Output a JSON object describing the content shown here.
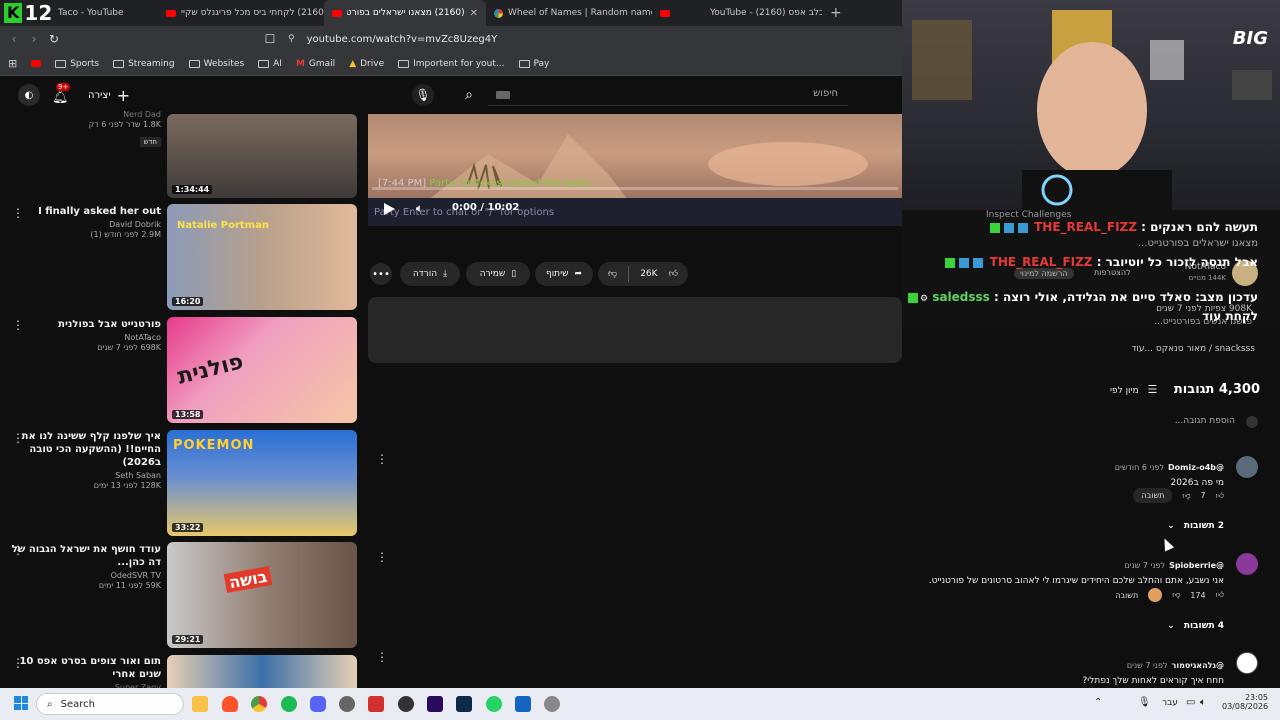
{
  "browser": {
    "tabs": [
      {
        "label": "Taco - YouTube",
        "active": false
      },
      {
        "label": "(2160) לקחתי ביס מכל פריגנלס שקיי",
        "active": false
      },
      {
        "label": "(2160) מצאנו ישראלים בפורטנייט",
        "active": true
      },
      {
        "label": "Wheel of Names | Random name pic",
        "active": false
      },
      {
        "label": "",
        "active": false
      },
      {
        "label": "YouTube - (2160) כלב אפס",
        "active": false
      }
    ],
    "url": "youtube.com/watch?v=mvZc8Uzeg4Y",
    "bookmarks": [
      "Sports",
      "Streaming",
      "Websites",
      "AI",
      "Gmail",
      "Drive",
      "Importent for yout...",
      "Pay"
    ]
  },
  "overlay_logo": {
    "k": "K",
    "num": "12"
  },
  "header": {
    "search_placeholder": "חיפוש",
    "create_label": "יצירה",
    "notif_count": "9+"
  },
  "related": [
    {
      "title": "",
      "channel": "Nerd Dad",
      "meta": "1.8K שדר לפני 6 דק",
      "badge": "חדש",
      "duration": "1:34:44",
      "colors": [
        "#6b5a50",
        "#2a2a2a"
      ]
    },
    {
      "title": "I finally asked her out",
      "channel": "David Dobrik",
      "meta": "2.9M לפני חודש (1)",
      "badge": "",
      "duration": "16:20",
      "thumb_text": "Natalie Portman",
      "colors": [
        "#7d8fb0",
        "#e8c2a8"
      ]
    },
    {
      "title": "פורטנייט אבל בפולנית",
      "channel": "NotATaco",
      "meta": "698K לפני 7 שנים",
      "badge": "",
      "duration": "13:58",
      "thumb_text": "פולנית",
      "colors": [
        "#e83a8a",
        "#f5c7a5"
      ]
    },
    {
      "title": "איך שלפנו קלף ששינה לנו את החיים!! (ההשקעה הכי טובה ב2026)",
      "channel": "Seth Saban",
      "meta": "128K לפני 13 ימים",
      "badge": "",
      "duration": "33:22",
      "thumb_text": "POKEMON",
      "colors": [
        "#2a6fd6",
        "#ffcf33"
      ]
    },
    {
      "title": "עודד חושף את ישראל הגבוה של דה כהן...",
      "channel": "OdedSVR TV",
      "meta": "59K לפני 11 ימים",
      "badge": "",
      "duration": "29:21",
      "thumb_text": "בושה",
      "colors": [
        "#c9c9c9",
        "#e23a2a"
      ]
    },
    {
      "title": "תום ואור צופים בסרט אפס 10 שנים אחרי",
      "channel": "Super Zagy",
      "meta": "",
      "badge": "",
      "duration": "",
      "colors": [
        "#3b6fa8",
        "#e7d0b5"
      ]
    }
  ],
  "player": {
    "overlay_time": "[7:44 PM]",
    "overlay_party": "Party: Sn4cksss joined the party",
    "hint": "Party   Enter to chat or \"/\" for options",
    "time": "0:00 / 10:02"
  },
  "actions": {
    "likes": "26K",
    "share": "שיתוף",
    "save": "שמירה",
    "download": "הורדה"
  },
  "chat": {
    "inspect": "Inspect Challenges",
    "messages": [
      {
        "name": "THE_REAL_FIZZ",
        "text": "תעשה להם ראנקים",
        "color": "red"
      },
      {
        "name": "THE_REAL_FIZZ",
        "text": "אבל תנסה לזכור כל יוטיובר",
        "color": "red"
      },
      {
        "name": "saledsss",
        "text": "עדכון מצב: סאלד סיים את הגלידה, אולי רוצה",
        "text2": "לקחת עוד",
        "color": "green"
      }
    ],
    "bg_lines": [
      "מצאנו ישראלים בפורטנייט...",
      "NotATaco",
      "144K מנויים",
      "908K צפיות  לפני 7 שנים",
      "פגשנו אנשים בפורטנייט..."
    ],
    "bg_buttons": [
      "להצטרפות",
      "הרשמה למינוי"
    ]
  },
  "credits": {
    "line": "snacksss / מאור סנאקס ...עוד"
  },
  "comments": {
    "count": "4,300 תגובות",
    "sort_label": "מיון לפי",
    "add_placeholder": "הוספת תגובה...",
    "items": [
      {
        "author": "@Domiz-o4b",
        "time": "לפני 6 חודשים",
        "text": "מי פה ב2026",
        "likes": "7",
        "reply": "תשובה",
        "replies": "2 תשובות",
        "avatar": "#5a6a7a"
      },
      {
        "author": "@Spioberrie",
        "time": "לפני 7 שנים",
        "text": "אני נשבע, אתם והחלב שלכם היחידים שיגרמו לי לאהוב סרטונים של פורטנייט.",
        "likes": "174",
        "reply": "תשובה",
        "replies": "4 תשובות",
        "avatar": "#8a3a9a"
      },
      {
        "author": "@גלהאגיסמור",
        "time": "לפני 7 שנים",
        "text": "חחח איך קוראים לאחות שלך נפתלי?",
        "likes": "",
        "reply": "",
        "replies": "",
        "avatar": "#ffffff"
      }
    ]
  },
  "taskbar": {
    "search": "Search",
    "lang": "עבר",
    "time": "23:05",
    "date": "03/08/2026"
  },
  "cam_logo": "BIG"
}
